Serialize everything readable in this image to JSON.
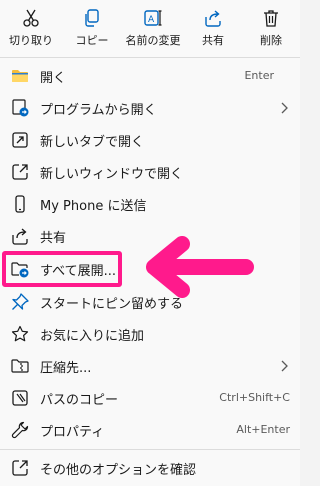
{
  "toolbar": {
    "cut": "切り取り",
    "copy": "コピー",
    "rename": "名前の変更",
    "share": "共有",
    "delete": "削除"
  },
  "menu": {
    "open": {
      "label": "開く",
      "shortcut": "Enter"
    },
    "open_with": {
      "label": "プログラムから開く"
    },
    "open_new_tab": {
      "label": "新しいタブで開く"
    },
    "open_new_window": {
      "label": "新しいウィンドウで開く"
    },
    "send_to_phone": {
      "label": "My Phone に送信"
    },
    "share": {
      "label": "共有"
    },
    "extract_all": {
      "label": "すべて展開..."
    },
    "pin_to_start": {
      "label": "スタートにピン留めする"
    },
    "add_favorites": {
      "label": "お気に入りに追加"
    },
    "compress_to": {
      "label": "圧縮先..."
    },
    "copy_as_path": {
      "label": "パスのコピー",
      "shortcut": "Ctrl+Shift+C"
    },
    "properties": {
      "label": "プロパティ",
      "shortcut": "Alt+Enter"
    },
    "show_more_options": {
      "label": "その他のオプションを確認"
    }
  },
  "colors": {
    "accent": "#0067c0",
    "highlight": "#ff1a8c",
    "folder": "#f4bd3c"
  }
}
